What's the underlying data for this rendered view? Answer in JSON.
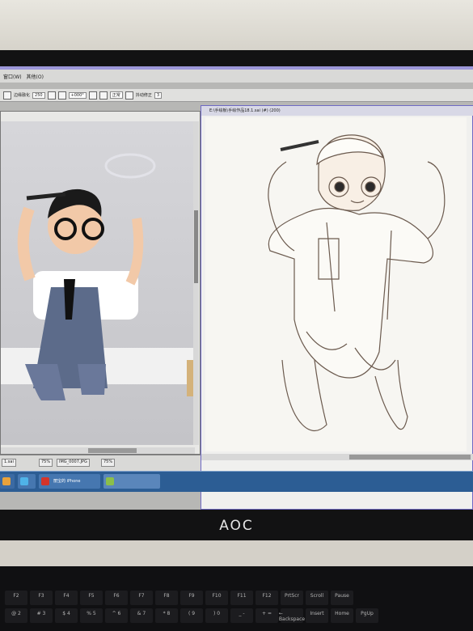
{
  "menu": [
    "窗口(W)",
    "其他(O)"
  ],
  "toolbar": {
    "check_label": "边缘融化",
    "value_1": "250",
    "value_2": "+000°",
    "mode": "正常",
    "stabilizer_label": "抖动修正",
    "stabilizer_value": "3"
  },
  "canvas_window": {
    "title": "E:\\手绘板\\手绘作品18.1.sai (#) (200)"
  },
  "statusbar": {
    "items": [
      "1.sai",
      "75%",
      "IMG_0007.JPG",
      "75%"
    ]
  },
  "taskbar": {
    "apps": [
      "丽宝的 iPhone"
    ]
  },
  "monitor_brand": "AOC",
  "keyboard": {
    "fn_keys": [
      "F2",
      "F3",
      "F4",
      "F5",
      "F6",
      "F7",
      "F8",
      "F9",
      "F10",
      "F11",
      "F12",
      "PrtScr",
      "Scroll",
      "Pause"
    ],
    "num_keys": [
      "@ 2",
      "# 3",
      "$ 4",
      "% 5",
      "^ 6",
      "& 7",
      "* 8",
      "( 9",
      ") 0",
      "_ -",
      "+ =",
      "← Backspace",
      "Insert",
      "Home",
      "PgUp"
    ]
  }
}
